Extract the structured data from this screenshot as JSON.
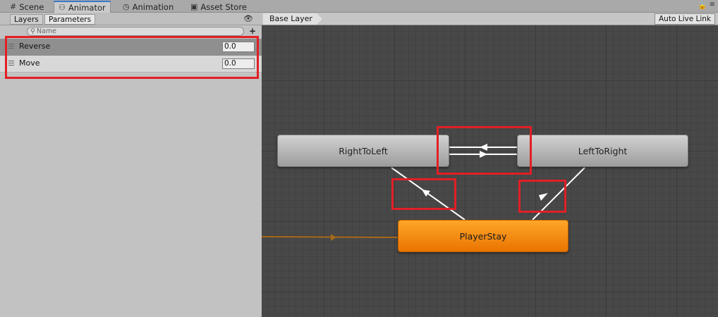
{
  "window_tabs": [
    {
      "label": "Scene",
      "icon": "grid-icon"
    },
    {
      "label": "Animator",
      "icon": "animator-icon"
    },
    {
      "label": "Animation",
      "icon": "clock-icon"
    },
    {
      "label": "Asset Store",
      "icon": "store-icon"
    }
  ],
  "left_panel": {
    "tabs": [
      "Layers",
      "Parameters"
    ],
    "search_placeholder": "Name",
    "parameters": [
      {
        "name": "Reverse",
        "value": "0.0"
      },
      {
        "name": "Move",
        "value": "0.0"
      }
    ]
  },
  "graph": {
    "breadcrumb": "Base Layer",
    "auto_live_link": "Auto Live Link",
    "states": {
      "right_to_left": "RightToLeft",
      "left_to_right": "LeftToRight",
      "player_stay": "PlayerStay"
    }
  },
  "colors": {
    "highlight": "#e11f26",
    "default_state": "#f08c10",
    "entry_arrow": "#a7681a",
    "graph_bg": "#484848"
  }
}
